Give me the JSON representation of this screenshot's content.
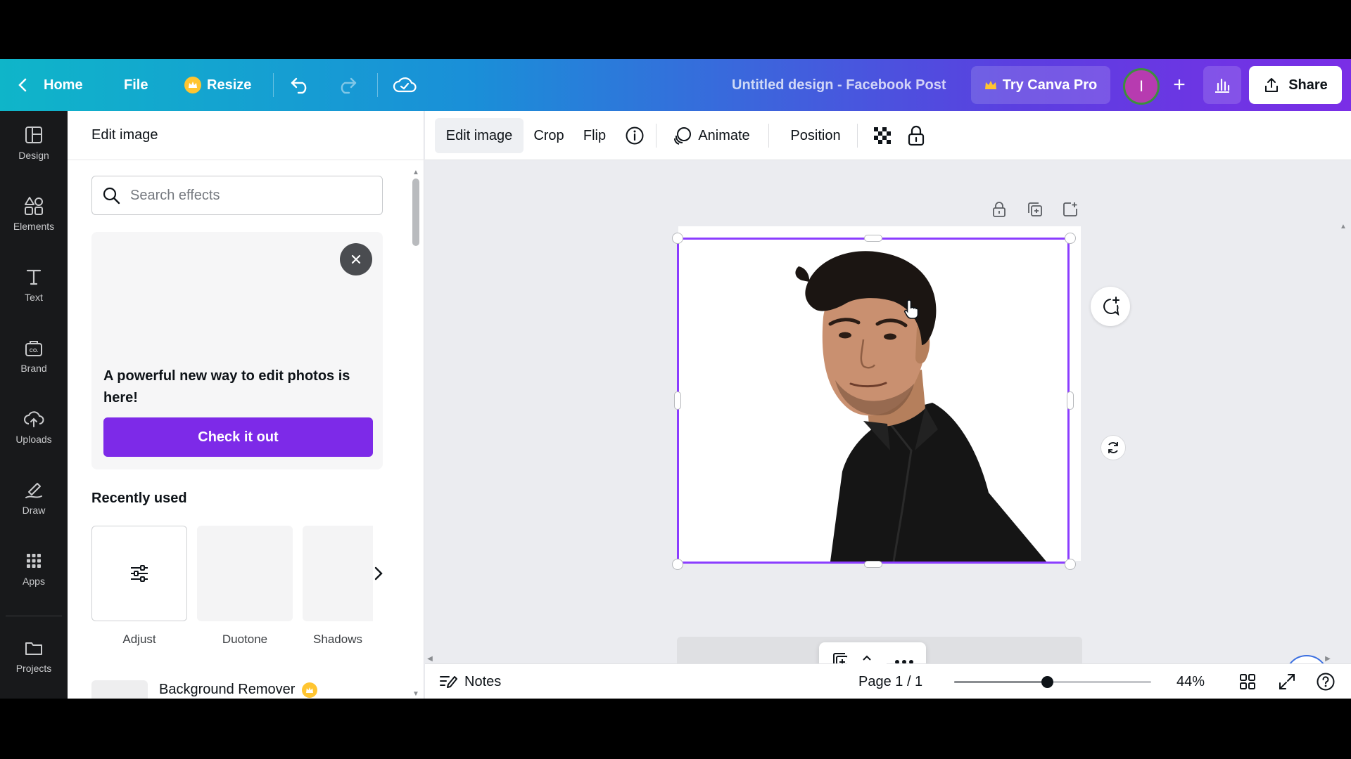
{
  "topbar": {
    "home_label": "Home",
    "file_label": "File",
    "resize_label": "Resize",
    "title": "Untitled design - Facebook Post",
    "pro_label": "Try Canva Pro",
    "avatar_initial": "I",
    "share_label": "Share"
  },
  "rail": {
    "items": [
      {
        "label": "Design",
        "icon": "layout-icon"
      },
      {
        "label": "Elements",
        "icon": "shapes-icon"
      },
      {
        "label": "Text",
        "icon": "text-icon"
      },
      {
        "label": "Brand",
        "icon": "brand-icon"
      },
      {
        "label": "Uploads",
        "icon": "cloud-upload-icon"
      },
      {
        "label": "Draw",
        "icon": "pen-icon"
      },
      {
        "label": "Apps",
        "icon": "grid-icon"
      },
      {
        "label": "Projects",
        "icon": "folder-icon"
      }
    ]
  },
  "panel": {
    "title": "Edit image",
    "search_placeholder": "Search effects",
    "promo_text": "A powerful new way to edit photos is here!",
    "promo_button": "Check it out",
    "recent_title": "Recently used",
    "recent_items": [
      "Adjust",
      "Duotone",
      "Shadows"
    ],
    "bg_remover_label": "Background Remover"
  },
  "context_toolbar": {
    "edit_image": "Edit image",
    "crop": "Crop",
    "flip": "Flip",
    "animate": "Animate",
    "position": "Position"
  },
  "bottombar": {
    "notes_label": "Notes",
    "page_indicator": "Page 1 / 1",
    "zoom_label": "44%",
    "zoom_fraction": 0.44
  },
  "colors": {
    "accent_purple": "#7d2ae8",
    "selection_border": "#8b3dff",
    "rail_bg": "#18191b"
  }
}
